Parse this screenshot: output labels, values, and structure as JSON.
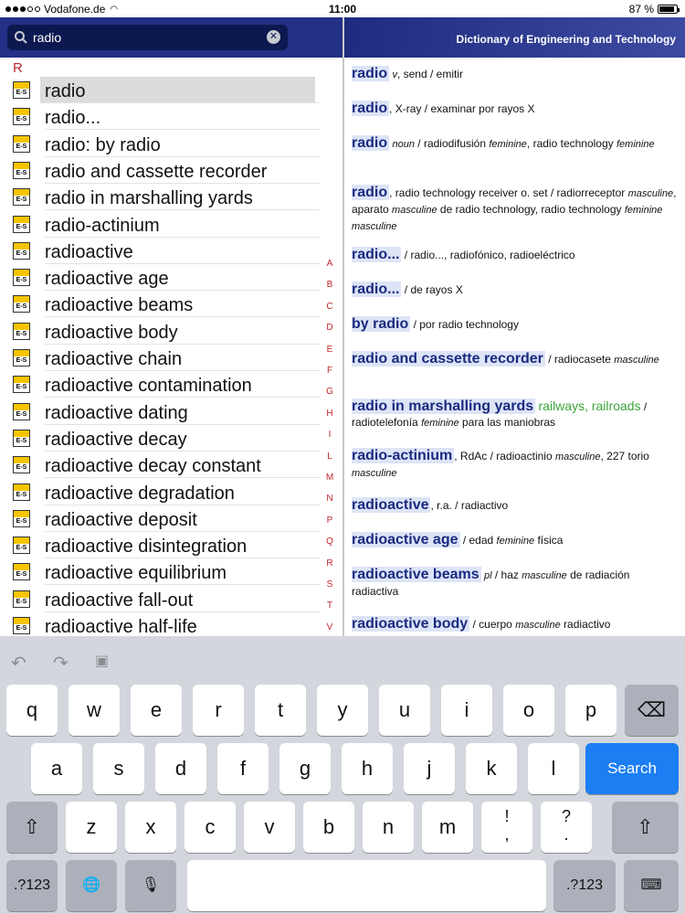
{
  "status": {
    "carrier": "Vodafone.de",
    "time": "11:00",
    "battery": "87 %",
    "battery_level": 0.87
  },
  "search": {
    "query": "radio"
  },
  "header": {
    "title": "Dictionary of Engineering and Technology"
  },
  "list": {
    "section": "R",
    "icon_text": "E-S",
    "selected_index": 0,
    "items": [
      "radio",
      "radio...",
      "radio: by radio",
      "radio and cassette recorder",
      "radio in marshalling yards",
      "radio-actinium",
      "radioactive",
      "radioactive age",
      "radioactive beams",
      "radioactive body",
      "radioactive chain",
      "radioactive contamination",
      "radioactive dating",
      "radioactive decay",
      "radioactive decay constant",
      "radioactive degradation",
      "radioactive deposit",
      "radioactive disintegration",
      "radioactive equilibrium",
      "radioactive fall-out",
      "radioactive half-life"
    ]
  },
  "alphabet": [
    "A",
    "B",
    "C",
    "D",
    "E",
    "F",
    "G",
    "H",
    "I",
    "L",
    "M",
    "N",
    "P",
    "Q",
    "R",
    "S",
    "T",
    "V"
  ],
  "entries": [
    {
      "hw": "radio",
      "parts": [
        {
          "t": " "
        },
        {
          "t": "v",
          "i": true
        },
        {
          "t": ", send / emitir"
        }
      ]
    },
    {
      "hw": "radio",
      "parts": [
        {
          "t": ", X-ray / examinar por rayos X"
        }
      ]
    },
    {
      "hw": "radio",
      "parts": [
        {
          "t": " "
        },
        {
          "t": "noun",
          "i": true
        },
        {
          "t": " / radiodifusión "
        },
        {
          "t": "feminine",
          "i": true
        },
        {
          "t": ", radio technology "
        },
        {
          "t": "feminine",
          "i": true
        }
      ]
    },
    {
      "hw": "radio",
      "parts": [
        {
          "t": ", radio technology receiver o. set / radiorreceptor "
        },
        {
          "t": "masculine",
          "i": true
        },
        {
          "t": ", aparato "
        },
        {
          "t": "masculine",
          "i": true
        },
        {
          "t": " de radio technology, radio technology "
        },
        {
          "t": "feminine masculine",
          "i": true
        }
      ]
    },
    {
      "hw": "radio...",
      "parts": [
        {
          "t": " / radio..., radiofónico, radioeléctrico"
        }
      ]
    },
    {
      "hw": "radio...",
      "parts": [
        {
          "t": " / de rayos X"
        }
      ]
    },
    {
      "hw": "by radio",
      "parts": [
        {
          "t": " / por radio technology"
        }
      ]
    },
    {
      "hw": "radio and cassette recorder",
      "parts": [
        {
          "t": " / radiocasete "
        },
        {
          "t": "masculine",
          "i": true
        }
      ]
    },
    {
      "hw": "radio in marshalling yards",
      "parts": [
        {
          "t": " "
        },
        {
          "t": "railways, railroads",
          "g": true
        },
        {
          "t": " / radiotelefonía "
        },
        {
          "t": "feminine",
          "i": true
        },
        {
          "t": " para las maniobras"
        }
      ]
    },
    {
      "hw": "radio-actinium",
      "parts": [
        {
          "t": ", RdAc / radioactinio "
        },
        {
          "t": "masculine",
          "i": true
        },
        {
          "t": ", 227 torio "
        },
        {
          "t": "masculine",
          "i": true
        }
      ]
    },
    {
      "hw": "radioactive",
      "parts": [
        {
          "t": ", r.a. / radiactivo"
        }
      ]
    },
    {
      "hw": "radioactive age",
      "parts": [
        {
          "t": " / edad "
        },
        {
          "t": "feminine",
          "i": true
        },
        {
          "t": " física"
        }
      ]
    },
    {
      "hw": "radioactive beams",
      "parts": [
        {
          "t": " "
        },
        {
          "t": "pl",
          "i": true
        },
        {
          "t": " / haz "
        },
        {
          "t": "masculine",
          "i": true
        },
        {
          "t": " de radiación radiactiva"
        }
      ]
    },
    {
      "hw": "radioactive body",
      "parts": [
        {
          "t": " / cuerpo "
        },
        {
          "t": "masculine",
          "i": true
        },
        {
          "t": " radiactivo"
        }
      ]
    }
  ],
  "keyboard": {
    "row1": [
      "q",
      "w",
      "e",
      "r",
      "t",
      "y",
      "u",
      "i",
      "o",
      "p"
    ],
    "row2": [
      "a",
      "s",
      "d",
      "f",
      "g",
      "h",
      "j",
      "k",
      "l"
    ],
    "row3": [
      "z",
      "x",
      "c",
      "v",
      "b",
      "n",
      "m",
      "!\n,",
      "?\n."
    ],
    "search_label": "Search",
    "numbers_label": ".?123"
  }
}
